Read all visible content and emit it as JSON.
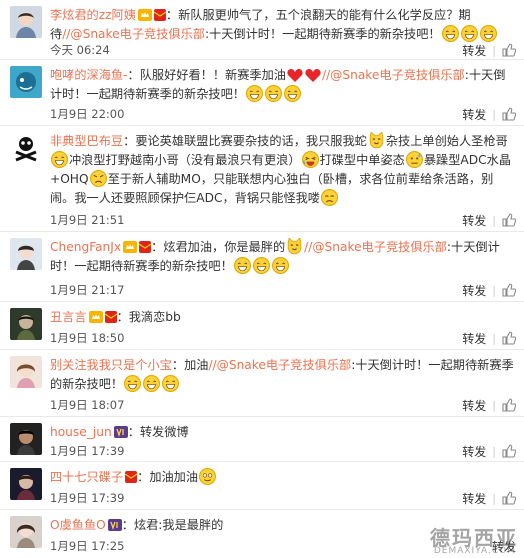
{
  "ui": {
    "repost_label": "转发",
    "accent": "#eb7350"
  },
  "watermark": {
    "brand": "德玛西亚",
    "site": "DEMAXIYA.COM"
  },
  "comments": [
    {
      "user": "李炫君的zz阿姨",
      "badges": [
        "vip-crown-icon",
        "red-envelope-icon"
      ],
      "colon": "：",
      "parts": [
        {
          "t": "新队服更帅气了，五个浪翻天的能有什么化学反应？期待"
        },
        {
          "m": "//@Snake电子竞技俱乐部"
        },
        {
          "t": ":十天倒计时！一起期待新赛季的新杂技吧！"
        }
      ],
      "emoji": [
        "grin",
        "grin",
        "grin"
      ],
      "time": "今天 06:24"
    },
    {
      "user": "咆哮的深海鱼-",
      "badges": [],
      "colon": "：",
      "parts": [
        {
          "t": "队服好好看！！新赛季加油"
        },
        {
          "e": "heart"
        },
        {
          "e": "heart"
        },
        {
          "m": "//@Snake电子竞技俱乐部"
        },
        {
          "t": ":十天倒计时！一起期待新赛季的新杂技吧！"
        }
      ],
      "emoji": [
        "grin",
        "grin",
        "grin"
      ],
      "time": "1月9日 22:00"
    },
    {
      "user": "非典型巴布豆",
      "badges": [],
      "colon": "：",
      "parts": [
        {
          "t": "要论英雄联盟比赛要杂技的话，我只服我蛇"
        },
        {
          "e": "cat"
        },
        {
          "t": "杂技上单创始人圣枪哥"
        },
        {
          "e": "grin"
        },
        {
          "t": "冲浪型打野越南小哥（没有最浪只有更浪）"
        },
        {
          "e": "laugh"
        },
        {
          "t": "打碟型中单姿态"
        },
        {
          "e": "sweat"
        },
        {
          "t": "暴躁型ADC水晶+OHQ"
        },
        {
          "e": "angry"
        },
        {
          "t": "至于新人辅助MO，只能联想内心独白（卧槽，求各位前辈给条活路，别闹。我一人还要照顾保护仨ADC，背锅只能怪我喽"
        },
        {
          "e": "sad"
        }
      ],
      "emoji": [],
      "time": "1月9日 21:51"
    },
    {
      "user": "ChengFanJx",
      "badges": [
        "vip-crown-icon",
        "red-envelope-icon"
      ],
      "colon": "：",
      "parts": [
        {
          "t": "炫君加油，你是最胖的"
        },
        {
          "e": "cat"
        },
        {
          "m": "//@Snake电子竞技俱乐部"
        },
        {
          "t": ":十天倒计时！一起期待新赛季的新杂技吧！"
        }
      ],
      "emoji": [
        "grin",
        "grin",
        "grin"
      ],
      "time": "1月9日 21:17"
    },
    {
      "user": "丑言言",
      "badges": [
        "vip-crown-icon",
        "red-envelope-icon"
      ],
      "colon": "：",
      "parts": [
        {
          "t": "我滴恋bb"
        }
      ],
      "emoji": [],
      "time": "1月9日 18:50"
    },
    {
      "user": "别关注我我只是个小宝",
      "badges": [],
      "colon": "：",
      "parts": [
        {
          "t": "加油"
        },
        {
          "m": "//@Snake电子竞技俱乐部"
        },
        {
          "t": ":十天倒计时！一起期待新赛季的新杂技吧！"
        }
      ],
      "emoji": [
        "grin",
        "grin",
        "grin"
      ],
      "time": "1月9日 18:07"
    },
    {
      "user": "house_jun",
      "badges": [
        "vip-badge-icon"
      ],
      "colon": "：",
      "parts": [
        {
          "t": "转发微博"
        }
      ],
      "emoji": [],
      "time": "1月9日 17:39"
    },
    {
      "user": "四十七只碟子",
      "badges": [
        "red-envelope-icon"
      ],
      "colon": "：",
      "parts": [
        {
          "t": "加油加油"
        }
      ],
      "emoji": [
        "smile"
      ],
      "time": "1月9日 17:39"
    },
    {
      "user": "O虞鱼鱼O",
      "badges": [
        "vip-badge-icon"
      ],
      "colon": "：",
      "parts": [
        {
          "t": "炫君:我是最胖的"
        }
      ],
      "emoji": [],
      "time": "1月9日 17:25"
    }
  ]
}
